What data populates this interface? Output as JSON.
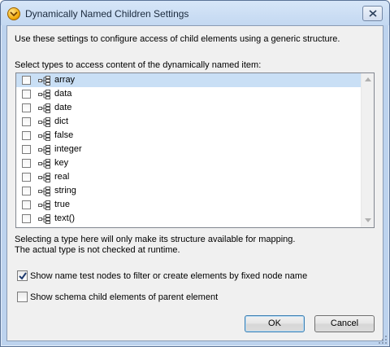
{
  "window": {
    "title": "Dynamically Named Children Settings"
  },
  "intro_text": "Use these settings to configure access of child elements using a generic structure.",
  "list_label": "Select types to access content of the dynamically named item:",
  "type_list": {
    "items": [
      {
        "label": "array",
        "checked": false,
        "selected": true
      },
      {
        "label": "data",
        "checked": false,
        "selected": false
      },
      {
        "label": "date",
        "checked": false,
        "selected": false
      },
      {
        "label": "dict",
        "checked": false,
        "selected": false
      },
      {
        "label": "false",
        "checked": false,
        "selected": false
      },
      {
        "label": "integer",
        "checked": false,
        "selected": false
      },
      {
        "label": "key",
        "checked": false,
        "selected": false
      },
      {
        "label": "real",
        "checked": false,
        "selected": false
      },
      {
        "label": "string",
        "checked": false,
        "selected": false
      },
      {
        "label": "true",
        "checked": false,
        "selected": false
      },
      {
        "label": "text()",
        "checked": false,
        "selected": false
      }
    ]
  },
  "note_line1": "Selecting a type here will only make its structure available for mapping.",
  "note_line2": "The actual type is not checked at runtime.",
  "options": {
    "show_name_test": {
      "label": "Show name test nodes to filter or create elements by fixed node name",
      "checked": true
    },
    "show_schema_child": {
      "label": "Show schema child elements of parent element",
      "checked": false
    }
  },
  "buttons": {
    "ok": "OK",
    "cancel": "Cancel"
  },
  "colors": {
    "selection": "#c9dff5",
    "window_frame": "#bdd3ee",
    "dialog_bg": "#f0f0f0"
  }
}
